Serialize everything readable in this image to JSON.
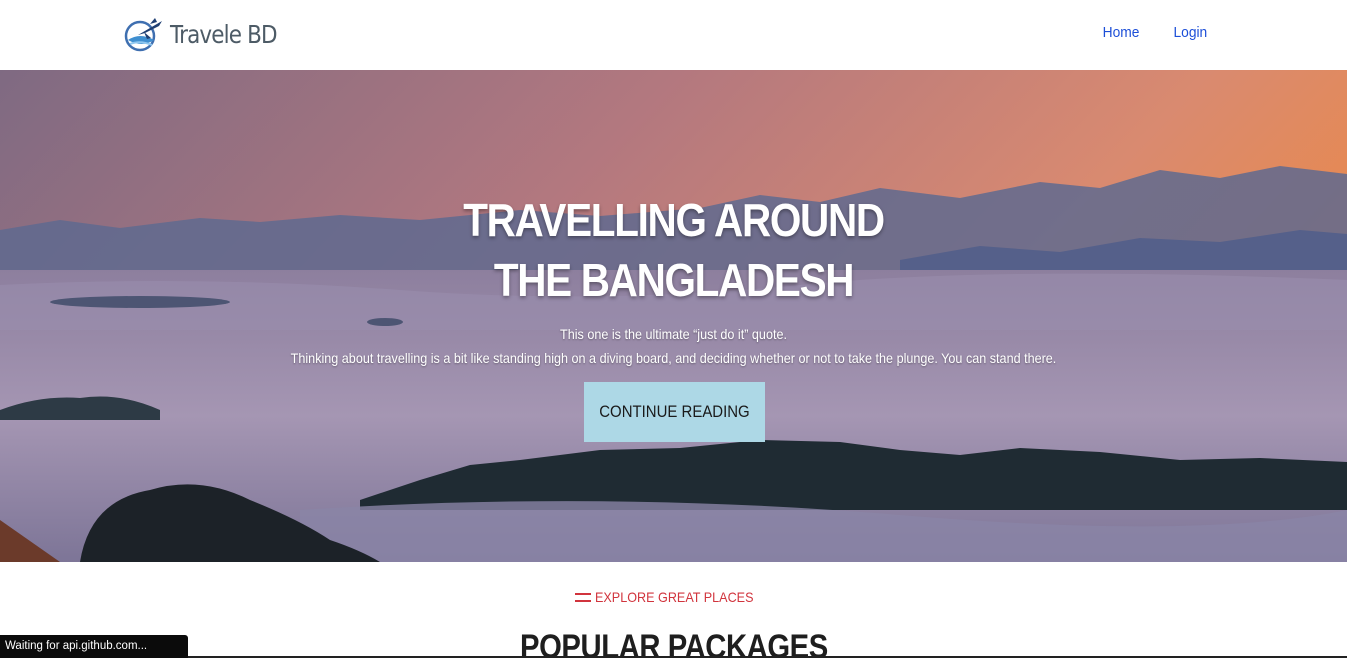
{
  "navbar": {
    "brand_name": "Travele BD",
    "logo_icon": "plane-globe-logo-icon",
    "links": [
      {
        "label": "Home"
      },
      {
        "label": "Login"
      }
    ],
    "link_color": "#1d4fd8"
  },
  "hero": {
    "title_line1": "TRAVELLING AROUND",
    "title_line2": "THE BANGLADESH",
    "text_line1": "This one is the ultimate “just do it” quote.",
    "text_line2": "Thinking about travelling is a bit like standing high on a diving board, and deciding whether or not to take the plunge. You can stand there.",
    "cta_label": "CONTINUE READING",
    "cta_color": "#add8e6"
  },
  "section": {
    "eyebrow_icon": "double-line-icon",
    "eyebrow": "EXPLORE GREAT PLACES",
    "title": "POPULAR PACKAGES",
    "accent_color": "#d1343d"
  },
  "status_bar": {
    "text": "Waiting for api.github.com..."
  }
}
